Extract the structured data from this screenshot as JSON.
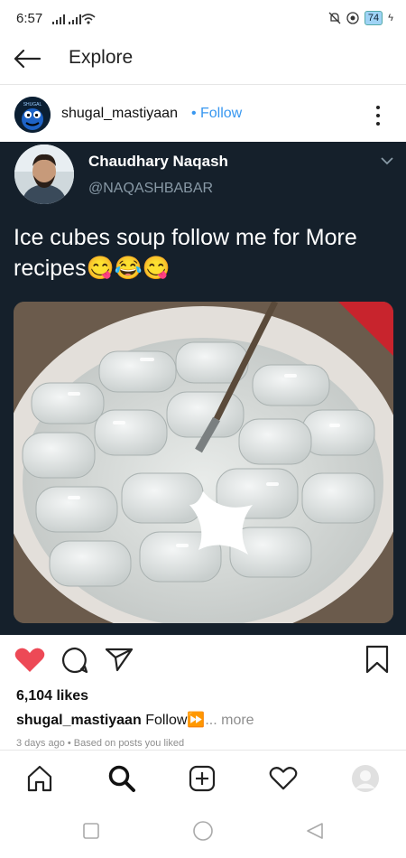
{
  "status_bar": {
    "time": "6:57",
    "battery": "74"
  },
  "header": {
    "title": "Explore"
  },
  "post": {
    "username": "shugal_mastiyaan",
    "follow_label": "Follow",
    "tweet": {
      "name": "Chaudhary Naqash",
      "handle": "@NAQASHBABAR",
      "text": "Ice cubes soup follow me for More recipes😋😂😋"
    },
    "likes": "6,104 likes",
    "caption": {
      "username": "shugal_mastiyaan",
      "text": "Follow⏩",
      "more": "... more"
    },
    "meta": "3 days ago • Based on posts you liked"
  },
  "colors": {
    "accent": "#3897f0",
    "like": "#ed4956",
    "tweet_bg": "#15202b"
  },
  "icons": [
    "back-arrow-icon",
    "more-icon",
    "heart-icon",
    "comment-icon",
    "share-icon",
    "bookmark-icon",
    "home-icon",
    "search-icon",
    "add-icon",
    "activity-icon",
    "profile-icon"
  ]
}
